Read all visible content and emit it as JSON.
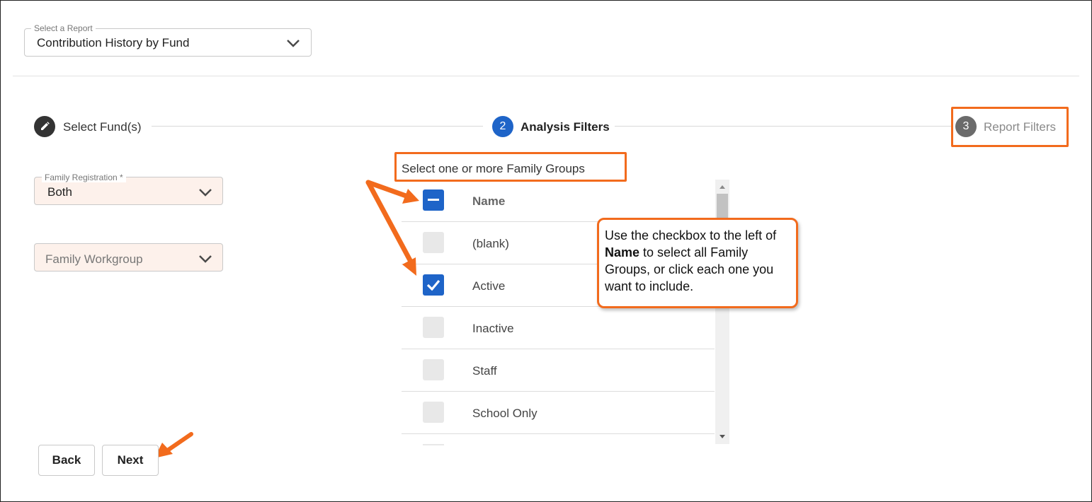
{
  "report": {
    "legend": "Select a Report",
    "value": "Contribution History by Fund"
  },
  "stepper": {
    "step1": {
      "label": "Select Fund(s)",
      "icon": "pencil-icon"
    },
    "step2": {
      "number": "2",
      "label": "Analysis Filters"
    },
    "step3": {
      "number": "3",
      "label": "Report Filters"
    }
  },
  "filters": {
    "family_registration": {
      "legend": "Family Registration *",
      "value": "Both"
    },
    "family_workgroup": {
      "placeholder": "Family Workgroup"
    }
  },
  "groups": {
    "prompt": "Select one or more Family Groups",
    "header": "Name",
    "items": [
      {
        "label": "(blank)",
        "checked": false
      },
      {
        "label": "Active",
        "checked": true
      },
      {
        "label": "Inactive",
        "checked": false
      },
      {
        "label": "Staff",
        "checked": false
      },
      {
        "label": "School Only",
        "checked": false
      }
    ]
  },
  "callout": {
    "line1": "Use the checkbox to the left of ",
    "bold": "Name",
    "line2": " to select all Family Groups, or click each one you want to include."
  },
  "buttons": {
    "back": "Back",
    "next": "Next"
  },
  "colors": {
    "accent": "#1e64c8",
    "highlight": "#f26b1d",
    "step_done": "#333333",
    "step_pending": "#6b6b6b"
  }
}
